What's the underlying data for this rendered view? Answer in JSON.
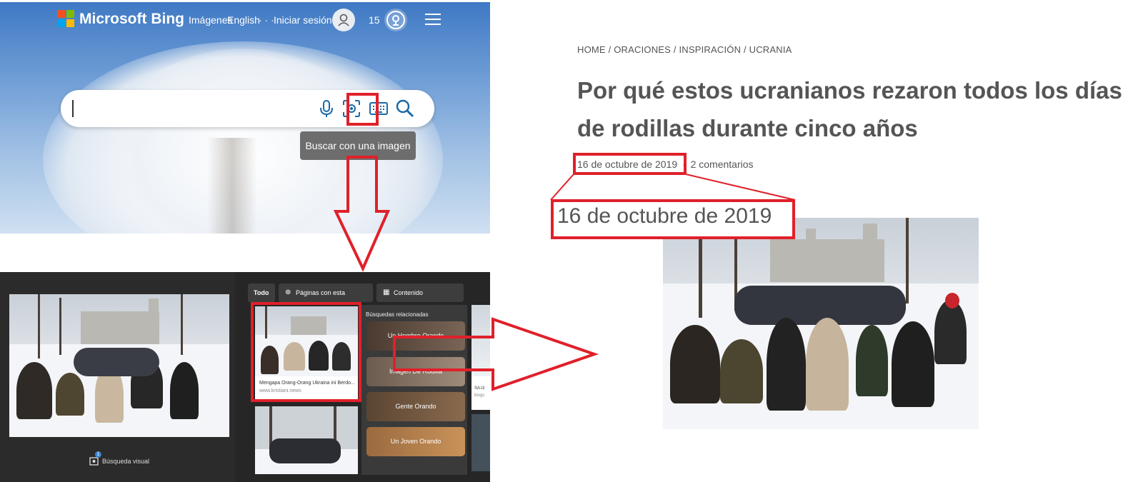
{
  "bing_home": {
    "brand": "Microsoft Bing",
    "nav_overlap_text": "Imágenes",
    "nav_language": "English",
    "nav_dots": "· · ·",
    "sign_in": "Iniciar sesión",
    "rewards_points": "15",
    "tooltip": "Buscar con una imagen",
    "icons": [
      "microphone-icon",
      "visual-search-icon",
      "keyboard-icon",
      "search-icon",
      "hamburger-menu-icon",
      "trophy-icon",
      "user-icon"
    ]
  },
  "visual_search": {
    "tabs": [
      {
        "label": "Todo",
        "active": true
      },
      {
        "label": "Páginas con esta imagen",
        "icon": "globe-icon"
      },
      {
        "label": "Contenido relacionado",
        "icon": "grid-icon"
      }
    ],
    "result_card": {
      "caption": "Mengapa Orang-Orang Ukraina ini Berdo...",
      "source": "www.kristiani.news"
    },
    "related_heading": "Búsquedas relacionadas",
    "related_searches": [
      "Un Hombre Orando",
      "Imagen De Rodilla",
      "Gente Orando",
      "Un Joven Orando"
    ],
    "side_snippet_1": "SA-tz",
    "side_snippet_2": "blogs",
    "visual_search_label": "Búsqueda visual",
    "visual_search_badge": "1"
  },
  "article": {
    "breadcrumb": "HOME / ORACIONES / INSPIRACIÓN / UCRANIA",
    "title": "Por qué estos ucranianos rezaron todos los días de rodillas durante cinco años",
    "date": "16 de octubre de 2019",
    "separator": "·",
    "comments": "2 comentarios",
    "date_zoomed": "16 de octubre de 2019"
  },
  "colors": {
    "annotation_red": "#e0202a",
    "dark_panel": "#2b2b2b",
    "article_text": "#555555"
  }
}
